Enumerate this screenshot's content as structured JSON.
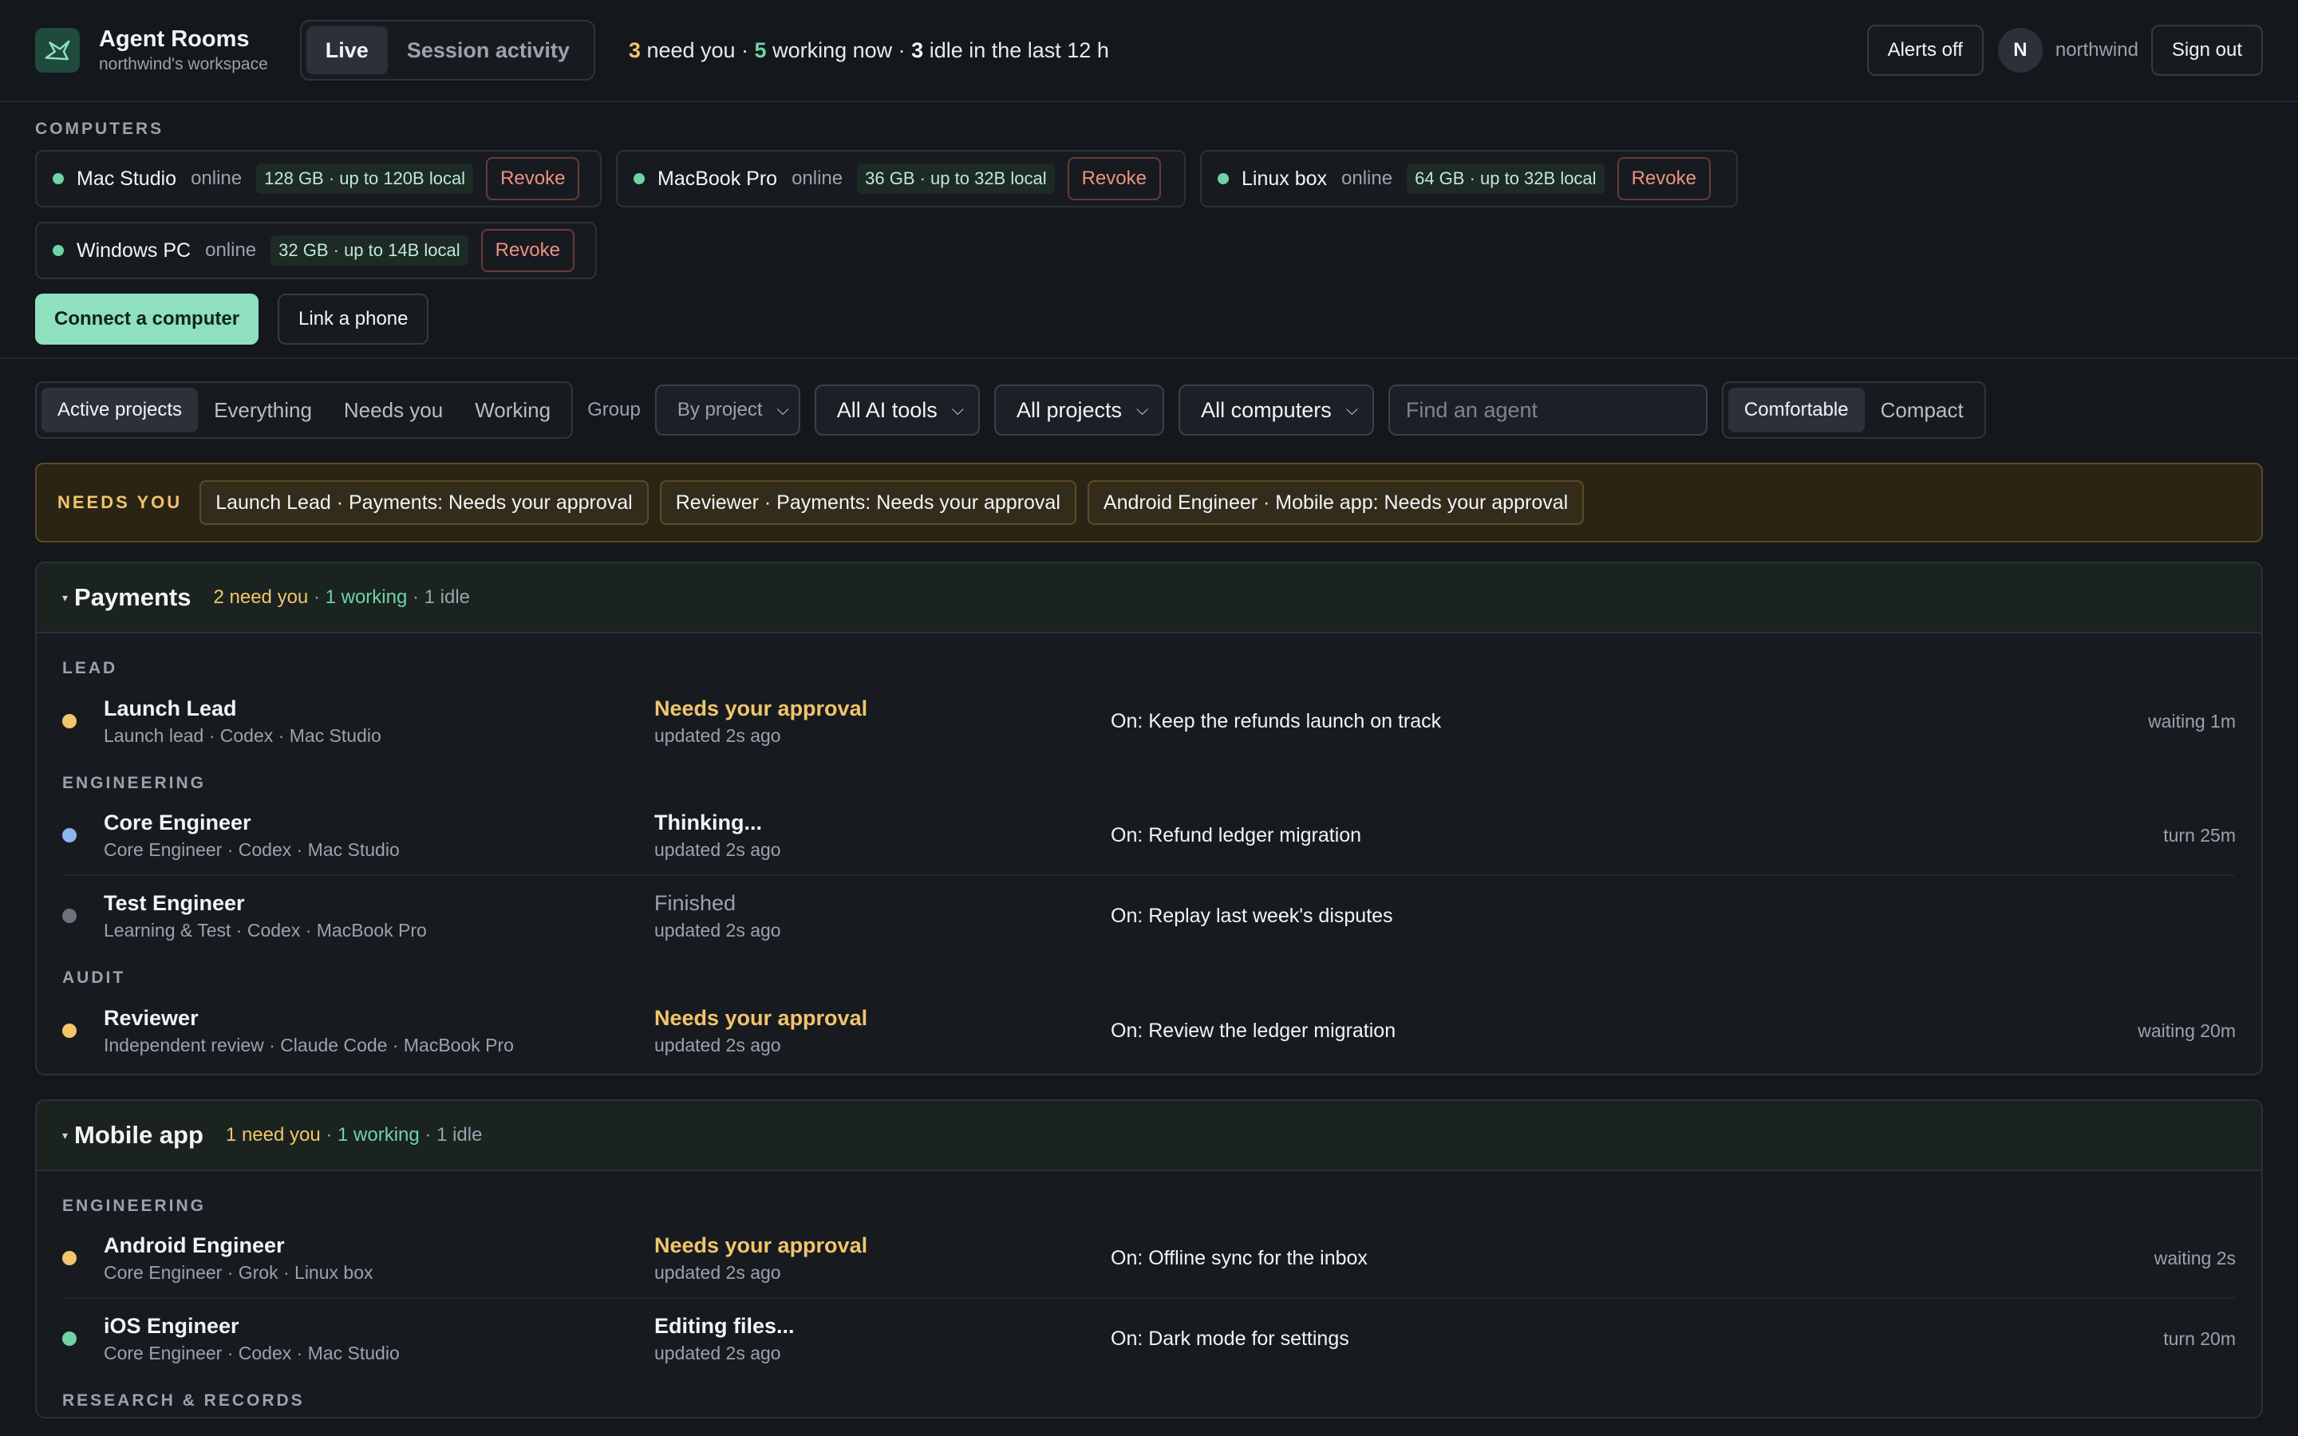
{
  "header": {
    "title": "Agent Rooms",
    "workspace": "northwind's workspace",
    "view_tabs": [
      "Live",
      "Session activity"
    ],
    "summary": {
      "need_count": "3",
      "need_text": " need you · ",
      "working_count": "5",
      "working_text": " working now · ",
      "idle_count": "3",
      "idle_text": " idle in the last 12 h"
    },
    "alerts_label": "Alerts off",
    "avatar_initial": "N",
    "username": "northwind",
    "signout_label": "Sign out"
  },
  "computers": {
    "label": "COMPUTERS",
    "items": [
      {
        "name": "Mac Studio",
        "status": "online",
        "spec": "128 GB · up to 120B local",
        "action": "Revoke"
      },
      {
        "name": "MacBook Pro",
        "status": "online",
        "spec": "36 GB · up to 32B local",
        "action": "Revoke"
      },
      {
        "name": "Linux box",
        "status": "online",
        "spec": "64 GB · up to 32B local",
        "action": "Revoke"
      },
      {
        "name": "Windows PC",
        "status": "online",
        "spec": "32 GB · up to 14B local",
        "action": "Revoke"
      }
    ],
    "connect_label": "Connect a computer",
    "phone_label": "Link a phone"
  },
  "filters": {
    "tabs": [
      "Active projects",
      "Everything",
      "Needs you",
      "Working"
    ],
    "group_label": "Group",
    "group_value": "By project",
    "tools_value": "All AI tools",
    "projects_value": "All projects",
    "computers_value": "All computers",
    "search_placeholder": "Find an agent",
    "density": [
      "Comfortable",
      "Compact"
    ]
  },
  "needs_you": {
    "label": "NEEDS YOU",
    "items": [
      "Launch Lead · Payments: Needs your approval",
      "Reviewer · Payments: Needs your approval",
      "Android Engineer · Mobile app: Needs your approval"
    ]
  },
  "projects": [
    {
      "name": "Payments",
      "stats": {
        "need": "2 need you",
        "sep1": " · ",
        "working": "1 working",
        "sep2": " · ",
        "idle": "1 idle"
      },
      "groups": [
        {
          "role": "LEAD",
          "agents": [
            {
              "name": "Launch Lead",
              "meta": "Launch lead · Codex · Mac Studio",
              "status": "Needs your approval",
              "updated": "updated 2s ago",
              "task": "On: Keep the refunds launch on track",
              "time": "waiting 1m"
            }
          ]
        },
        {
          "role": "ENGINEERING",
          "agents": [
            {
              "name": "Core Engineer",
              "meta": "Core Engineer · Codex · Mac Studio",
              "status": "Thinking...",
              "updated": "updated 2s ago",
              "task": "On: Refund ledger migration",
              "time": "turn 25m"
            },
            {
              "name": "Test Engineer",
              "meta": "Learning & Test · Codex · MacBook Pro",
              "status": "Finished",
              "updated": "updated 2s ago",
              "task": "On: Replay last week's disputes",
              "time": ""
            }
          ]
        },
        {
          "role": "AUDIT",
          "agents": [
            {
              "name": "Reviewer",
              "meta": "Independent review · Claude Code · MacBook Pro",
              "status": "Needs your approval",
              "updated": "updated 2s ago",
              "task": "On: Review the ledger migration",
              "time": "waiting 20m"
            }
          ]
        }
      ]
    },
    {
      "name": "Mobile app",
      "stats": {
        "need": "1 need you",
        "sep1": " · ",
        "working": "1 working",
        "sep2": " · ",
        "idle": "1 idle"
      },
      "groups": [
        {
          "role": "ENGINEERING",
          "agents": [
            {
              "name": "Android Engineer",
              "meta": "Core Engineer · Grok · Linux box",
              "status": "Needs your approval",
              "updated": "updated 2s ago",
              "task": "On: Offline sync for the inbox",
              "time": "waiting 2s"
            },
            {
              "name": "iOS Engineer",
              "meta": "Core Engineer · Codex · Mac Studio",
              "status": "Editing files...",
              "updated": "updated 2s ago",
              "task": "On: Dark mode for settings",
              "time": "turn 20m"
            }
          ]
        },
        {
          "role": "RESEARCH & RECORDS",
          "agents": []
        }
      ]
    }
  ],
  "colors": {
    "background": "#14171c",
    "amber": "#f2c46b",
    "green": "#6fd3a5",
    "blue": "#8fb2f0",
    "muted": "#6b727c",
    "danger": "#f08f84",
    "primary": "#8fe0bf"
  },
  "icons": {
    "logo": "bird-logo-icon",
    "online": "status-dot-icon",
    "dropdown": "chevron-down-icon",
    "collapse": "caret-down-icon"
  }
}
